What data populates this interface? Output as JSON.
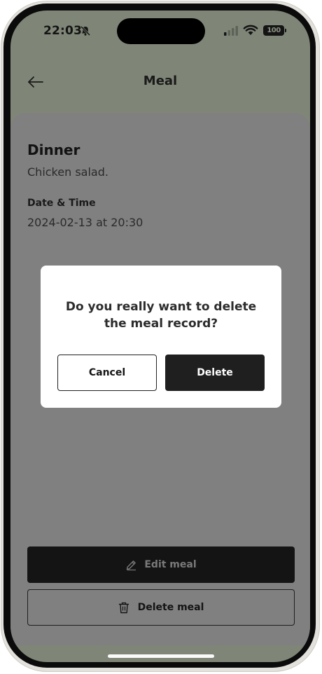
{
  "status_bar": {
    "time": "22:03",
    "battery": "100",
    "icons": [
      "bell-slash-icon",
      "signal-icon",
      "wifi-icon",
      "battery-icon"
    ]
  },
  "header": {
    "back_icon": "arrow-left-icon",
    "title": "Meal"
  },
  "meal": {
    "name": "Dinner",
    "description": "Chicken salad.",
    "datetime_label": "Date & Time",
    "datetime_value": "2024-02-13 at 20:30"
  },
  "actions": {
    "edit_label": "Edit meal",
    "edit_icon": "pencil-icon",
    "delete_label": "Delete meal",
    "delete_icon": "trash-icon"
  },
  "dialog": {
    "message": "Do you really want to delete the meal record?",
    "cancel_label": "Cancel",
    "confirm_label": "Delete"
  },
  "colors": {
    "overlay_background": "#7f8677",
    "card_background": "#808080",
    "dialog_background": "#ffffff",
    "primary_button": "#1f1f1f"
  }
}
